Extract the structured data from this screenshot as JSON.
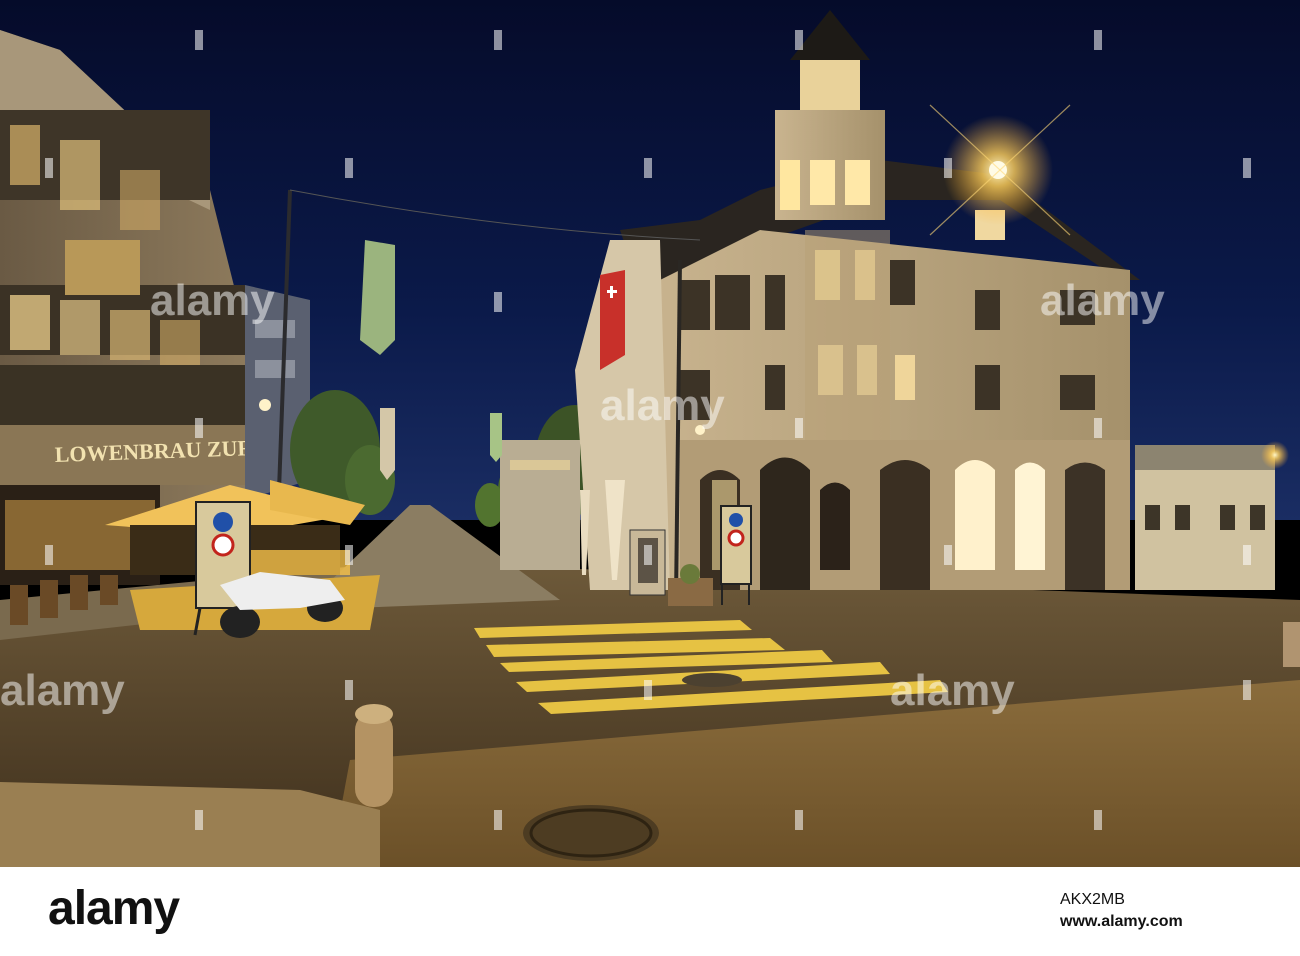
{
  "photo": {
    "signs": {
      "restaurant": "LOWENBRAU ZURICH"
    }
  },
  "watermarks": {
    "mark": "alamy"
  },
  "footer": {
    "logo": "alamy",
    "image_id": "AKX2MB",
    "site": "www.alamy.com"
  }
}
